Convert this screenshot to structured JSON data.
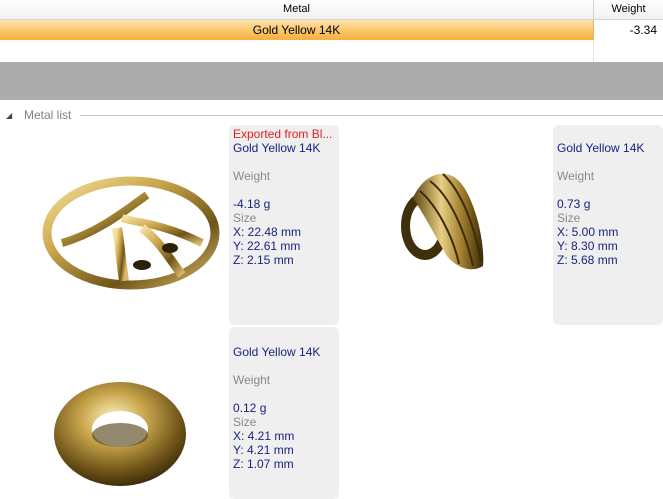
{
  "grid": {
    "columns": {
      "metal": "Metal",
      "weight": "Weight"
    },
    "rows": [
      {
        "metal": "Gold Yellow 14K",
        "weight": "-3.34"
      }
    ]
  },
  "metal_list": {
    "title": "Metal list",
    "items": [
      {
        "warning": "Exported from Bl...",
        "metal": "Gold Yellow 14K",
        "weight_label": "Weight",
        "weight": "-4.18 g",
        "size_label": "Size",
        "x": "X: 22.48 mm",
        "y": "Y: 22.61 mm",
        "z": "Z: 2.15 mm",
        "thumbnail_icon": "oval-frame-ring-icon"
      },
      {
        "metal": "Gold Yellow 14K",
        "weight_label": "Weight",
        "weight": "0.73 g",
        "size_label": "Size",
        "x": "X: 5.00 mm",
        "y": "Y: 8.30 mm",
        "z": "Z: 5.68 mm",
        "thumbnail_icon": "fluted-ring-icon"
      },
      {
        "metal": "Gold Yellow 14K",
        "weight_label": "Weight",
        "weight": "0.12 g",
        "size_label": "Size",
        "x": "X: 4.21 mm",
        "y": "Y: 4.21 mm",
        "z": "Z: 1.07 mm",
        "thumbnail_icon": "torus-ring-icon"
      }
    ]
  },
  "colors": {
    "selected_row": "#fbc86e",
    "info_text": "#1a237e",
    "warning_text": "#e01e1e",
    "card_bg": "#efefef"
  }
}
